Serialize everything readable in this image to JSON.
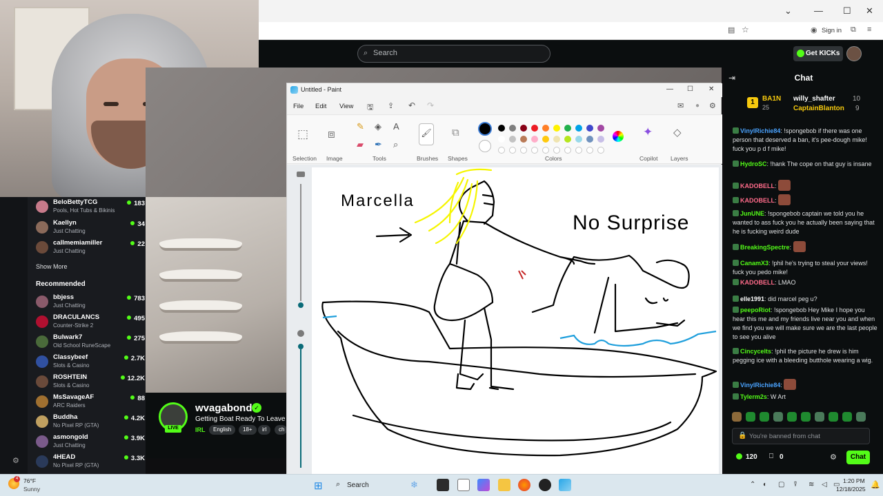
{
  "webcam": {
    "label": "streamer-webcam"
  },
  "browser": {
    "sign_in": "Sign in",
    "window_buttons": [
      "⌄",
      "—",
      "☐",
      "✕"
    ]
  },
  "kick_header": {
    "search_placeholder": "Search",
    "get_kicks": "Get KICKs"
  },
  "sidebar": {
    "followed": [
      {
        "name": "BeloBettyTCG",
        "category": "Pools, Hot Tubs & Bikinis",
        "viewers": "183"
      },
      {
        "name": "Kaellyn",
        "category": "Just Chatting",
        "viewers": "34"
      },
      {
        "name": "callmemiamiller",
        "category": "Just Chatting",
        "viewers": "22"
      }
    ],
    "show_more": "Show More",
    "recommended_heading": "Recommended",
    "recommended": [
      {
        "name": "bbjess",
        "category": "Just Chatting",
        "viewers": "783"
      },
      {
        "name": "DRACULANCS",
        "category": "Counter-Strike 2",
        "viewers": "495"
      },
      {
        "name": "Bulwark7",
        "category": "Old School RuneScape",
        "viewers": "275"
      },
      {
        "name": "Classybeef",
        "category": "Slots & Casino",
        "viewers": "2.7K"
      },
      {
        "name": "ROSHTEIN",
        "category": "Slots & Casino",
        "viewers": "12.2K"
      },
      {
        "name": "MsSavageAF",
        "category": "ARC Raiders",
        "viewers": "88"
      },
      {
        "name": "Buddha",
        "category": "No Pixel RP (GTA)",
        "viewers": "4.2K"
      },
      {
        "name": "asmongold",
        "category": "Just Chatting",
        "viewers": "3.9K"
      },
      {
        "name": "4HEAD",
        "category": "No Pixel RP (GTA)",
        "viewers": "3.3K"
      }
    ]
  },
  "stream": {
    "channel": "wvagabond",
    "live": "LIVE",
    "title": "Getting Boat Ready To Leave",
    "category": "IRL",
    "tags": [
      "English",
      "18+",
      "irl",
      "ch"
    ]
  },
  "paint": {
    "title": "Untitled - Paint",
    "menu": [
      "File",
      "Edit",
      "View"
    ],
    "groups": [
      "Selection",
      "Image",
      "Tools",
      "Brushes",
      "Shapes",
      "Colors",
      "Copilot",
      "Layers"
    ],
    "palette_row1": [
      "#000000",
      "#7f7f7f",
      "#880015",
      "#ed1c24",
      "#ff7f27",
      "#fff200",
      "#22b14c",
      "#00a2e8",
      "#3f48cc",
      "#a349a4"
    ],
    "palette_row2": [
      "#ffffff",
      "#c3c3c3",
      "#b97a57",
      "#ffaec9",
      "#ffc90e",
      "#efe4b0",
      "#b5e61d",
      "#99d9ea",
      "#7092be",
      "#c8bfe7"
    ],
    "drawing": {
      "label_left": "Marcella",
      "label_right": "No Surprise"
    }
  },
  "chat": {
    "title": "Chat",
    "leaderboard": [
      {
        "rank": "1",
        "name": "BA1N",
        "count": "25"
      },
      {
        "name": "willy_shafter",
        "count": "10"
      },
      {
        "name": "CaptainBlanton",
        "count": "9"
      }
    ],
    "messages": [
      {
        "user": "VinylRichie84",
        "color": "#4aa3ff",
        "text": "!spongebob if there was one person that deserved a ban, it's pee-dough mike! fuck you p d f mike!"
      },
      {
        "user": "HydroSC",
        "color": "#53fc18",
        "text": "!hank The cope on that guy is insane"
      },
      {
        "user": "KADOBELL",
        "color": "#ff6b8a",
        "text": ""
      },
      {
        "user": "KADOBELL",
        "color": "#ff6b8a",
        "text": ""
      },
      {
        "user": "JunUNE",
        "color": "#53fc18",
        "text": "!spongebob captain we told you he wanted to ass fuck you he actually been saying that he is fucking weird dude"
      },
      {
        "user": "BreakingSpectre",
        "color": "#53fc18",
        "text": ""
      },
      {
        "user": "CanamX3",
        "color": "#53fc18",
        "text": "!phil he's trying to steal your views! fuck you pedo mike!"
      },
      {
        "user": "KADOBELL",
        "color": "#ff6b8a",
        "text": "LMAO"
      },
      {
        "user": "elle1991",
        "color": "#ffffff",
        "text": "did marcel peg u?"
      },
      {
        "user": "peepoRiot",
        "color": "#53fc18",
        "text": "!spongebob Hey Mike I hope you hear this me and my friends live near you and when we find you we will make sure we are the last people to see you alive"
      },
      {
        "user": "Cincycelts",
        "color": "#53fc18",
        "text": "!phil the picture he drew is him pegging ice with a bleeding butthole wearing a wig."
      },
      {
        "user": "VinylRichie84",
        "color": "#4aa3ff",
        "text": ""
      },
      {
        "user": "Tylerm2s",
        "color": "#53fc18",
        "text": "W Art"
      }
    ],
    "banned_text": "You're banned from chat",
    "kicks_count": "120",
    "gift_count": "0",
    "chat_button": "Chat"
  },
  "taskbar": {
    "temperature": "76°F",
    "weather": "Sunny",
    "search": "Search",
    "time": "1:20 PM",
    "date": "12/18/2025",
    "notification_count": "4"
  }
}
